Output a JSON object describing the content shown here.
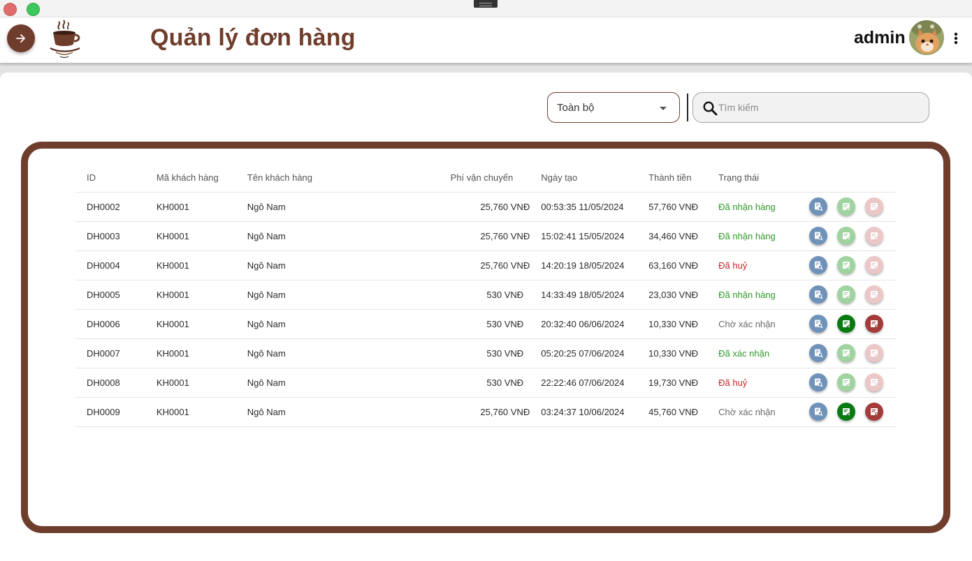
{
  "header": {
    "title": "Quản lý đơn hàng",
    "username": "admin"
  },
  "toolbar": {
    "filter_value": "Toàn bộ",
    "search_placeholder": "Tìm kiếm"
  },
  "table": {
    "columns": [
      "ID",
      "Mã khách hàng",
      "Tên khách hàng",
      "Phí vận chuyển",
      "Ngày tạo",
      "Thành tiền",
      "Trạng thái"
    ],
    "rows": [
      {
        "id": "DH0002",
        "ma_kh": "KH0001",
        "ten_kh": "Ngô Nam",
        "phi": "25,760 VNĐ",
        "ngay": "00:53:35 11/05/2024",
        "tien": "57,760 VNĐ",
        "trang_thai": "Đã nhận hàng",
        "status_kind": "green",
        "actions_active": false
      },
      {
        "id": "DH0003",
        "ma_kh": "KH0001",
        "ten_kh": "Ngô Nam",
        "phi": "25,760 VNĐ",
        "ngay": "15:02:41 15/05/2024",
        "tien": "34,460 VNĐ",
        "trang_thai": "Đã nhận hàng",
        "status_kind": "green",
        "actions_active": false
      },
      {
        "id": "DH0004",
        "ma_kh": "KH0001",
        "ten_kh": "Ngô Nam",
        "phi": "25,760 VNĐ",
        "ngay": "14:20:19 18/05/2024",
        "tien": "63,160 VNĐ",
        "trang_thai": "Đã huỷ",
        "status_kind": "red",
        "actions_active": false
      },
      {
        "id": "DH0005",
        "ma_kh": "KH0001",
        "ten_kh": "Ngô Nam",
        "phi": "530 VNĐ",
        "ngay": "14:33:49 18/05/2024",
        "tien": "23,030 VNĐ",
        "trang_thai": "Đã nhận hàng",
        "status_kind": "green",
        "actions_active": false
      },
      {
        "id": "DH0006",
        "ma_kh": "KH0001",
        "ten_kh": "Ngô Nam",
        "phi": "530 VNĐ",
        "ngay": "20:32:40 06/06/2024",
        "tien": "10,330 VNĐ",
        "trang_thai": "Chờ xác nhận",
        "status_kind": "grey",
        "actions_active": true
      },
      {
        "id": "DH0007",
        "ma_kh": "KH0001",
        "ten_kh": "Ngô Nam",
        "phi": "530 VNĐ",
        "ngay": "05:20:25 07/06/2024",
        "tien": "10,330 VNĐ",
        "trang_thai": "Đã xác nhận",
        "status_kind": "green",
        "actions_active": false
      },
      {
        "id": "DH0008",
        "ma_kh": "KH0001",
        "ten_kh": "Ngô Nam",
        "phi": "530 VNĐ",
        "ngay": "22:22:46 07/06/2024",
        "tien": "19,730 VNĐ",
        "trang_thai": "Đã huỷ",
        "status_kind": "red",
        "actions_active": false
      },
      {
        "id": "DH0009",
        "ma_kh": "KH0001",
        "ten_kh": "Ngô Nam",
        "phi": "25,760 VNĐ",
        "ngay": "03:24:37 10/06/2024",
        "tien": "45,760 VNĐ",
        "trang_thai": "Chờ xác nhận",
        "status_kind": "grey",
        "actions_active": true
      }
    ]
  },
  "icons": {
    "nav": "arrow-right-icon",
    "menu": "more-vertical-icon",
    "search": "search-icon",
    "view": "receipt-search-icon",
    "confirm": "receipt-check-icon",
    "cancel": "receipt-cancel-icon"
  },
  "colors": {
    "brand": "#6f3d2c",
    "status_green": "#2e9a27",
    "status_red": "#c62828",
    "status_grey": "#6a6a6a",
    "view_button": "#6f92b8",
    "confirm_active": "#0a7a12",
    "cancel_active": "#a53a3a"
  }
}
